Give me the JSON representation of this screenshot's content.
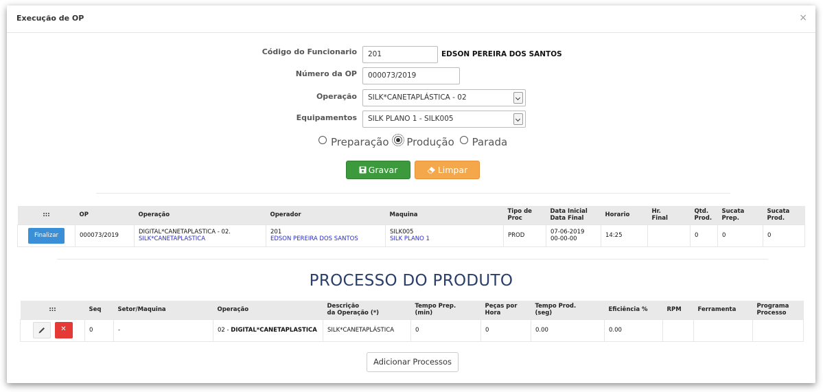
{
  "modal": {
    "title": "Execução de OP",
    "close": "×"
  },
  "form": {
    "funcionario_label": "Código do Funcionario",
    "funcionario_value": "201",
    "funcionario_name": "EDSON PEREIRA DOS SANTOS",
    "op_label": "Número da OP",
    "op_value": "000073/2019",
    "operacao_label": "Operação",
    "operacao_value": "SILK*CANETAPLÁSTICA - 02",
    "equipamentos_label": "Equipamentos",
    "equipamentos_value": "SILK PLANO 1 - SILK005",
    "radios": {
      "preparacao": "Preparação",
      "producao": "Produção",
      "parada": "Parada",
      "selected": "producao"
    },
    "gravar_label": "Gravar",
    "limpar_label": "Limpar"
  },
  "colors": {
    "green": "#3c9a3c",
    "orange": "#f4a74b",
    "blue": "#3a8fd6",
    "red": "#e53935",
    "link": "#2a2ac9",
    "title": "#2a3e6a"
  },
  "op_table": {
    "headers": {
      "actions": ":::",
      "op": "OP",
      "operacao": "Operação",
      "operador": "Operador",
      "maquina": "Maquina",
      "tipo_proc": "Tipo de Proc",
      "data_inicial": "Data Inicial",
      "data_final": "Data Final",
      "horario": "Horario",
      "hr_final_1": "Hr.",
      "hr_final_2": "Final",
      "qtd_prod_1": "Qtd.",
      "qtd_prod_2": "Prod.",
      "sucata_prep_1": "Sucata",
      "sucata_prep_2": "Prep.",
      "sucata_prod_1": "Sucata",
      "sucata_prod_2": "Prod."
    },
    "row": {
      "finalizar": "Finalizar",
      "op": "000073/2019",
      "operacao": "DIGITAL*CANETAPLASTICA - 02.",
      "operacao_link": "SILK*CANETAPLASTICA",
      "operador_code": "201",
      "operador_name": "EDSON PEREIRA DOS SANTOS",
      "maquina_code": "SILK005",
      "maquina_name": "SILK PLANO 1",
      "tipo_proc": "PROD",
      "data_inicial": "07-06-2019",
      "data_final": "00-00-00",
      "horario": "14:25",
      "hr_final": "",
      "qtd_prod": "0",
      "sucata_prep": "0",
      "sucata_prod": "0"
    }
  },
  "processo": {
    "title": "PROCESSO DO PRODUTO",
    "headers": {
      "actions": ":::",
      "seq": "Seq",
      "setor": "Setor/Maquina",
      "operacao": "Operação",
      "descricao_1": "Descrição",
      "descricao_2": "da Operação (*)",
      "tempo_prep_1": "Tempo Prep.",
      "tempo_prep_2": "(min)",
      "pecas_hora": "Peças por Hora",
      "tempo_prod_1": "Tempo Prod.",
      "tempo_prod_2": "(seg)",
      "eficiencia": "Eficiência %",
      "rpm": "RPM",
      "ferramenta": "Ferramenta",
      "programa_1": "Programa",
      "programa_2": "Processo"
    },
    "row": {
      "seq": "0",
      "setor": "-",
      "operacao_prefix": "02 - ",
      "operacao_bold": "DIGITAL*CANETAPLASTICA",
      "descricao": "SILK*CANETAPLÁSTICA",
      "tempo_prep": "0",
      "pecas_hora": "0",
      "tempo_prod": "0.00",
      "eficiencia": "0.00",
      "rpm": "",
      "ferramenta": "",
      "programa": ""
    },
    "add_button": "Adicionar Processos"
  }
}
